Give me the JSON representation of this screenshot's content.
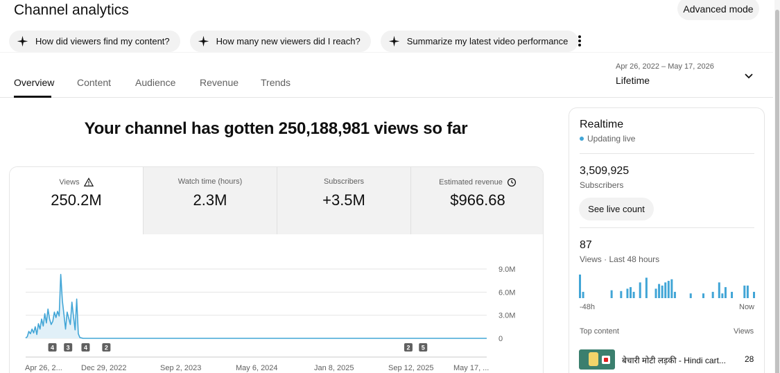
{
  "header": {
    "title": "Channel analytics",
    "advanced_mode": "Advanced mode"
  },
  "chips": [
    {
      "label": "How did viewers find my content?",
      "icon": "sparkle-icon"
    },
    {
      "label": "How many new viewers did I reach?",
      "icon": "sparkle-icon"
    },
    {
      "label": "Summarize my latest video performance",
      "icon": "sparkle-icon"
    }
  ],
  "tabs": [
    {
      "label": "Overview",
      "active": true
    },
    {
      "label": "Content",
      "active": false
    },
    {
      "label": "Audience",
      "active": false
    },
    {
      "label": "Revenue",
      "active": false
    },
    {
      "label": "Trends",
      "active": false
    }
  ],
  "date_picker": {
    "range": "Apr 26, 2022 – May 17, 2026",
    "label": "Lifetime"
  },
  "headline": "Your channel has gotten 250,188,981 views so far",
  "metrics": [
    {
      "label": "Views",
      "value": "250.2M",
      "icon": "warning-icon"
    },
    {
      "label": "Watch time (hours)",
      "value": "2.3M"
    },
    {
      "label": "Subscribers",
      "value": "+3.5M"
    },
    {
      "label": "Estimated revenue",
      "value": "$966.68",
      "icon": "clock-icon"
    }
  ],
  "chart_data": {
    "type": "area",
    "series": [
      {
        "values": [
          0.05,
          0.2,
          0.9,
          0.6,
          1.2,
          0.7,
          1.5,
          0.5,
          1.9,
          1.2,
          2.5,
          1.6,
          3.2,
          2.0,
          3.8,
          2.5,
          1.8,
          2.2,
          3.4,
          2.7,
          3.5,
          2.9,
          8.3,
          4.9,
          3.1,
          1.2,
          3.4,
          2.6,
          1.8,
          4.7,
          2.8,
          1.1,
          5.1,
          0.6,
          0.1,
          0.05,
          0,
          0,
          0,
          0,
          0,
          0,
          0,
          0,
          0,
          0,
          0,
          0,
          0,
          0,
          0,
          0,
          0,
          0,
          0,
          0,
          0,
          0,
          0,
          0,
          0,
          0,
          0,
          0,
          0,
          0,
          0,
          0,
          0,
          0,
          0,
          0,
          0,
          0,
          0,
          0,
          0,
          0,
          0,
          0,
          0,
          0,
          0,
          0,
          0,
          0,
          0,
          0,
          0,
          0,
          0,
          0,
          0,
          0,
          0,
          0,
          0,
          0,
          0,
          0,
          0,
          0,
          0,
          0,
          0,
          0,
          0,
          0,
          0,
          0,
          0,
          0,
          0,
          0,
          0,
          0,
          0,
          0,
          0,
          0,
          0,
          0,
          0,
          0,
          0,
          0,
          0,
          0,
          0,
          0,
          0,
          0,
          0,
          0,
          0,
          0,
          0,
          0,
          0,
          0,
          0,
          0,
          0,
          0,
          0,
          0,
          0,
          0,
          0,
          0,
          0,
          0,
          0,
          0,
          0,
          0,
          0,
          0,
          0,
          0,
          0,
          0,
          0,
          0,
          0,
          0,
          0,
          0,
          0,
          0,
          0,
          0,
          0,
          0,
          0,
          0,
          0,
          0,
          0,
          0,
          0,
          0,
          0,
          0,
          0,
          0,
          0,
          0,
          0,
          0,
          0,
          0,
          0,
          0,
          0,
          0,
          0,
          0,
          0,
          0,
          0,
          0,
          0,
          0,
          0,
          0,
          0,
          0,
          0,
          0,
          0,
          0,
          0,
          0,
          0,
          0,
          0,
          0,
          0,
          0,
          0,
          0,
          0,
          0,
          0,
          0,
          0,
          0,
          0,
          0,
          0,
          0,
          0,
          0,
          0,
          0,
          0,
          0,
          0,
          0,
          0,
          0,
          0,
          0,
          0,
          0,
          0,
          0,
          0,
          0,
          0,
          0,
          0,
          0,
          0,
          0,
          0,
          0,
          0,
          0,
          0,
          0,
          0,
          0,
          0,
          0,
          0,
          0,
          0,
          0,
          0,
          0,
          0,
          0,
          0,
          0,
          0,
          0,
          0,
          0,
          0,
          0,
          0,
          0,
          0,
          0,
          0,
          0,
          0,
          0
        ]
      }
    ],
    "y_ticks": [
      "9.0M",
      "6.0M",
      "3.0M",
      "0"
    ],
    "ylim": [
      0,
      9.0
    ],
    "x_ticks": [
      "Apr 26, 2...",
      "Dec 29, 2022",
      "Sep 2, 2023",
      "May 6, 2024",
      "Jan 8, 2025",
      "Sep 12, 2025",
      "May 17, ..."
    ],
    "markers": [
      {
        "label": "4",
        "at": 0.058
      },
      {
        "label": "3",
        "at": 0.092
      },
      {
        "label": "4",
        "at": 0.13
      },
      {
        "label": "2",
        "at": 0.175
      },
      {
        "label": "2",
        "at": 0.83
      },
      {
        "label": "5",
        "at": 0.862
      }
    ],
    "line_color": "#41a5d6",
    "fill_color": "#e1f0f8"
  },
  "realtime": {
    "title": "Realtime",
    "status": "Updating live",
    "subscribers": "3,509,925",
    "subscribers_label": "Subscribers",
    "live_count_button": "See live count",
    "views": "87",
    "views_label": "Views · Last 48 hours",
    "bars": [
      30,
      8,
      0,
      0,
      0,
      0,
      0,
      0,
      0,
      0,
      10,
      0,
      0,
      9,
      0,
      12,
      14,
      8,
      0,
      20,
      0,
      26,
      0,
      0,
      12,
      18,
      16,
      20,
      22,
      24,
      8,
      0,
      0,
      0,
      0,
      6,
      0,
      0,
      0,
      6,
      0,
      0,
      8,
      0,
      20,
      6,
      14,
      0,
      8,
      0,
      0,
      0,
      16,
      16,
      0,
      8
    ],
    "axis_left": "-48h",
    "axis_right": "Now",
    "top_content_label": "Top content",
    "views_col_label": "Views",
    "top_item_title": "बेचारी मोटी लड़की - Hindi cart...",
    "top_item_views": "28"
  }
}
